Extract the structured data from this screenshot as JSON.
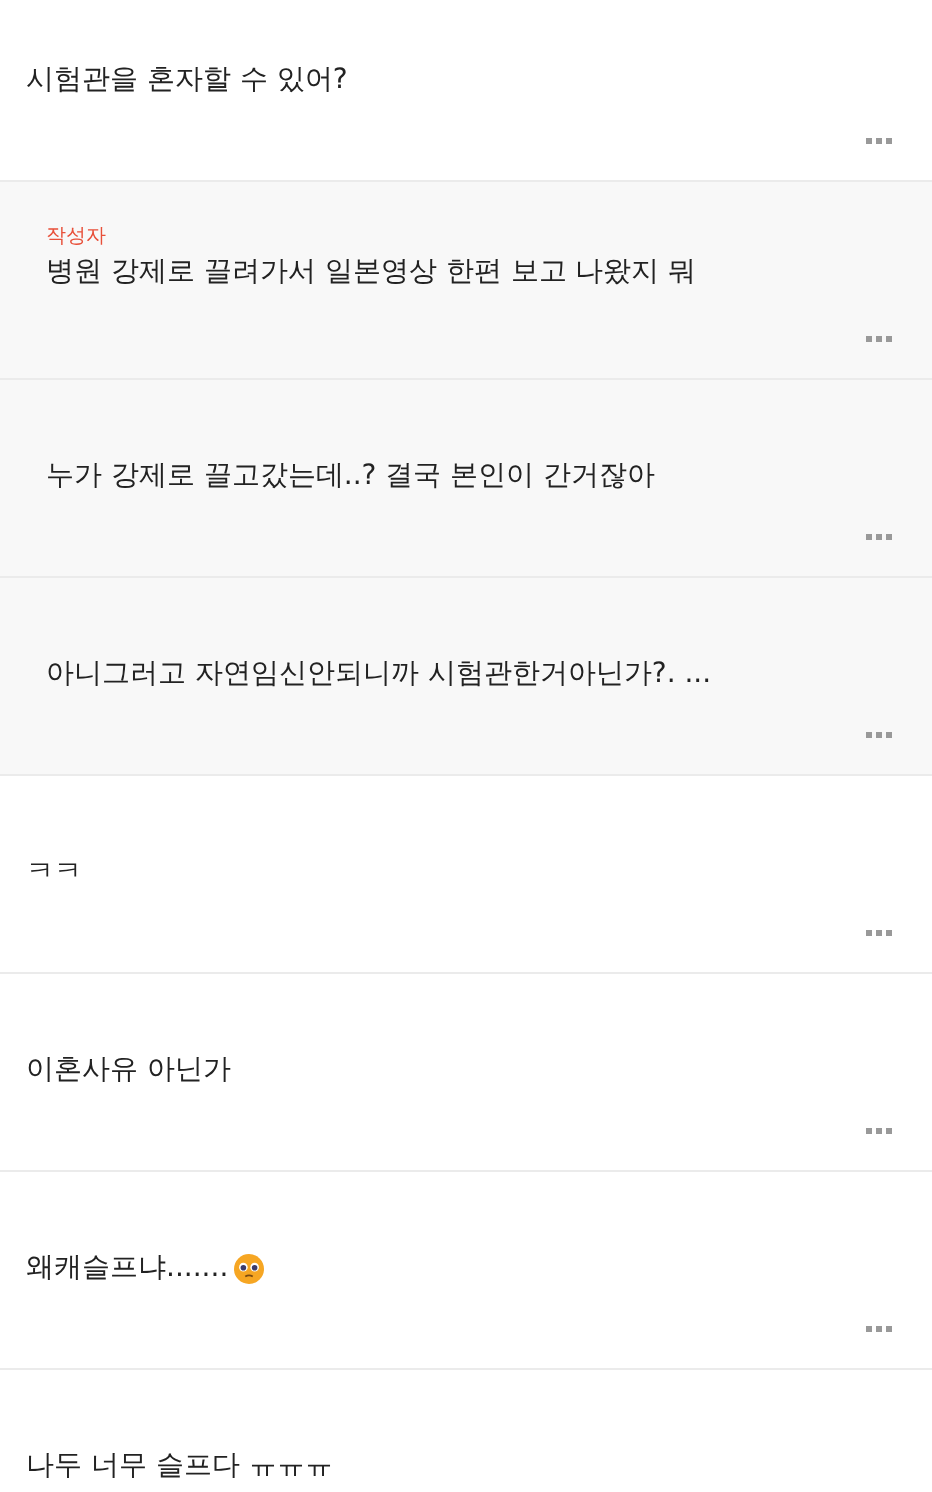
{
  "comments": [
    {
      "text": "시험관을 혼자할 수 있어?",
      "reply": false
    },
    {
      "text": "병원 강제로 끌려가서 일본영상 한편 보고 나왔지 뭐",
      "reply": true,
      "author_tag": "작성자"
    },
    {
      "text": "누가 강제로 끌고갔는데..? 결국 본인이 간거잖아",
      "reply": true
    },
    {
      "text": "아니그러고 자연임신안되니까 시험관한거아닌가?. ...",
      "reply": true
    },
    {
      "text": "ㅋㅋ",
      "reply": false
    },
    {
      "text": "이혼사유 아닌가",
      "reply": false
    },
    {
      "text": "왜캐슬프냐.......",
      "reply": false,
      "emoji": true
    },
    {
      "text": "나두 너무 슬프다 ㅠㅠㅠ",
      "reply": false
    }
  ]
}
